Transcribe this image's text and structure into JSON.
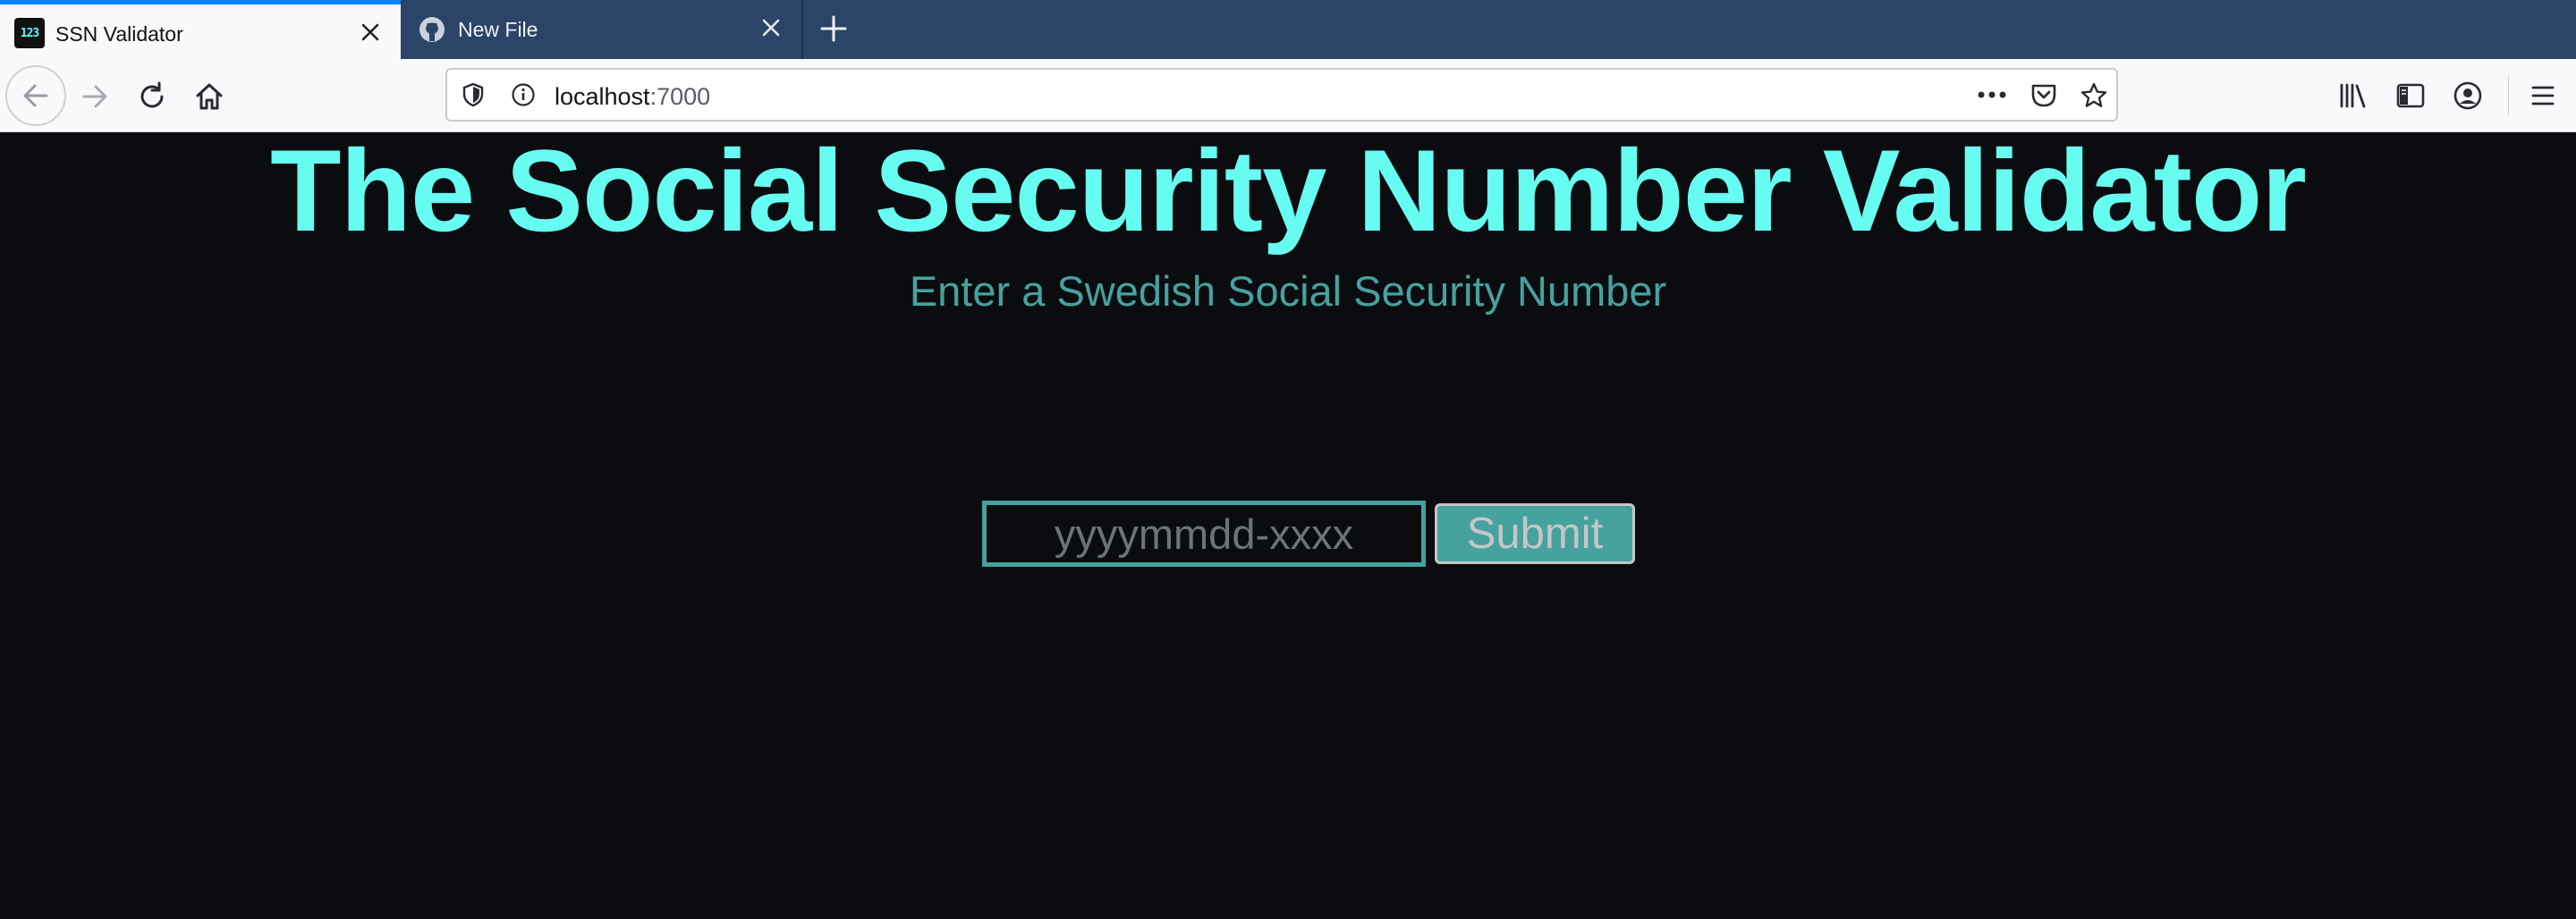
{
  "browser": {
    "tabs": [
      {
        "title": "SSN Validator",
        "favicon": "123-icon",
        "active": true
      },
      {
        "title": "New File",
        "favicon": "github-icon",
        "active": false
      }
    ],
    "favicon_text": "123",
    "address": {
      "host": "localhost",
      "port": ":7000"
    }
  },
  "page": {
    "title": "The Social Security Number Validator",
    "subtitle": "Enter a Swedish Social Security Number",
    "input": {
      "value": "",
      "placeholder": "yyyymmdd-xxxx"
    },
    "submit_label": "Submit"
  },
  "colors": {
    "accent": "#66fcf1",
    "secondary": "#45a29e",
    "background": "#0b0c10",
    "tab_strip": "#2b4468"
  }
}
